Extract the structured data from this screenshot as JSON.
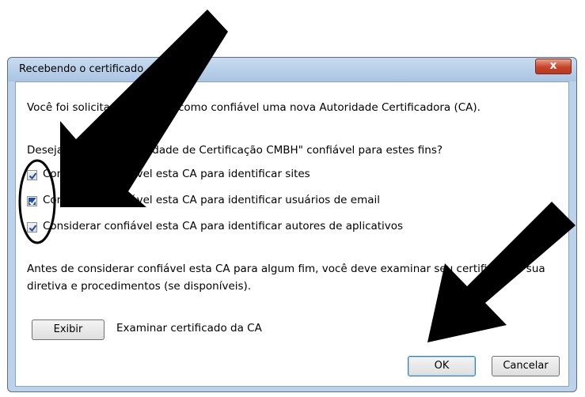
{
  "dialog": {
    "title": "Recebendo o certificado",
    "close_label": "x",
    "intro": "Você foi solicitado a marcar como confiável uma nova Autoridade Certificadora (CA).",
    "question": "Deseja considerar \"Entidade de Certificação CMBH\" confiável para estes fins?",
    "options": [
      {
        "label": "Considerar confiável esta CA para identificar sites",
        "checked": true
      },
      {
        "label": "Considerar confiável esta CA para identificar usuários de email",
        "checked": true
      },
      {
        "label": "Considerar confiável esta CA para identificar autores de aplicativos",
        "checked": true
      }
    ],
    "notice_line1": "Antes de considerar confiável esta CA para algum fim, você deve examinar seu certificado e sua",
    "notice_line2": "diretiva e procedimentos (se disponíveis).",
    "view_button": "Exibir",
    "view_desc": "Examinar certificado da CA",
    "ok_button": "OK",
    "cancel_button": "Cancelar"
  },
  "colors": {
    "frame": "#bcd2ea",
    "close": "#c7442a",
    "checkbox": "#1d4ea0",
    "annotation": "#000000"
  }
}
